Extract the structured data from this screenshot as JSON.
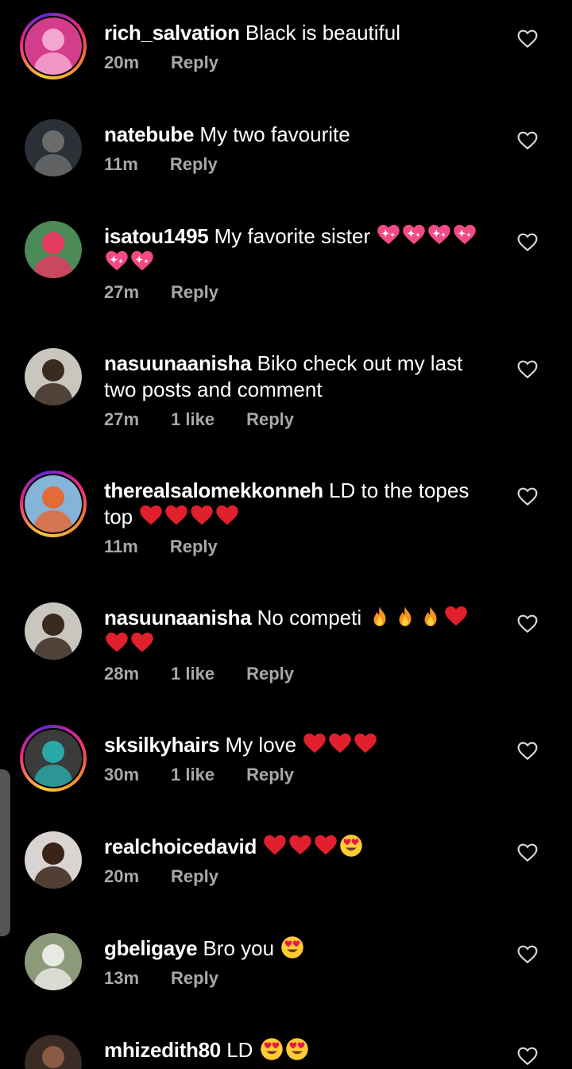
{
  "comments": [
    {
      "username": "rich_salvation",
      "text": "Black is beautiful",
      "time": "20m",
      "likes": "",
      "reply": "Reply",
      "story_ring": true,
      "av_bg": "#d43c8c",
      "av_fg": "#f5a6d0"
    },
    {
      "username": "natebube",
      "text": "My two favourite",
      "time": "11m",
      "likes": "",
      "reply": "Reply",
      "story_ring": false,
      "av_bg": "#2b2f36",
      "av_fg": "#6b6b6b"
    },
    {
      "username": "isatou1495",
      "text": "My favorite sister",
      "emoji": "sparkling-heart-x6",
      "time": "27m",
      "likes": "",
      "reply": "Reply",
      "story_ring": false,
      "av_bg": "#4c8a57",
      "av_fg": "#e23b5f"
    },
    {
      "username": "nasuunaanisha",
      "text": "Biko check out my last two posts and comment",
      "time": "27m",
      "likes": "1 like",
      "reply": "Reply",
      "story_ring": false,
      "av_bg": "#c9c6bf",
      "av_fg": "#3a2a20"
    },
    {
      "username": "therealsalomekkonneh",
      "text": "LD to the topes top",
      "emoji": "red-heart-x4",
      "time": "11m",
      "likes": "",
      "reply": "Reply",
      "story_ring": true,
      "av_bg": "#86b3d8",
      "av_fg": "#e26b3a"
    },
    {
      "username": "nasuunaanisha",
      "text": "No competi",
      "emoji": "fire-x3-red-heart-x3",
      "time": "28m",
      "likes": "1 like",
      "reply": "Reply",
      "story_ring": false,
      "av_bg": "#c9c6bf",
      "av_fg": "#3a2a20"
    },
    {
      "username": "sksilkyhairs",
      "text": "My love",
      "emoji": "red-heart-x3",
      "time": "30m",
      "likes": "1 like",
      "reply": "Reply",
      "story_ring": true,
      "av_bg": "#3b3b3b",
      "av_fg": "#2aa7a7"
    },
    {
      "username": "realchoicedavid",
      "text": "",
      "emoji": "red-heart-x3-heart-eyes",
      "time": "20m",
      "likes": "",
      "reply": "Reply",
      "story_ring": false,
      "av_bg": "#d9d4d2",
      "av_fg": "#3a2418"
    },
    {
      "username": "gbeligaye",
      "text": "Bro you",
      "emoji": "heart-eyes-x1",
      "time": "13m",
      "likes": "",
      "reply": "Reply",
      "story_ring": false,
      "av_bg": "#8c9a7a",
      "av_fg": "#e8e8e4"
    },
    {
      "username": "mhizedith80",
      "text": "LD",
      "emoji": "heart-eyes-x2",
      "time": "",
      "likes": "",
      "reply": "",
      "story_ring": false,
      "av_bg": "#3a2b24",
      "av_fg": "#8a5a44"
    }
  ],
  "icons": {
    "like": "heart-outline-icon"
  },
  "colors": {
    "background": "#000000",
    "meta": "#a8a8a8",
    "ring_start": "#f9ce34",
    "ring_end": "#ee2a7b"
  }
}
